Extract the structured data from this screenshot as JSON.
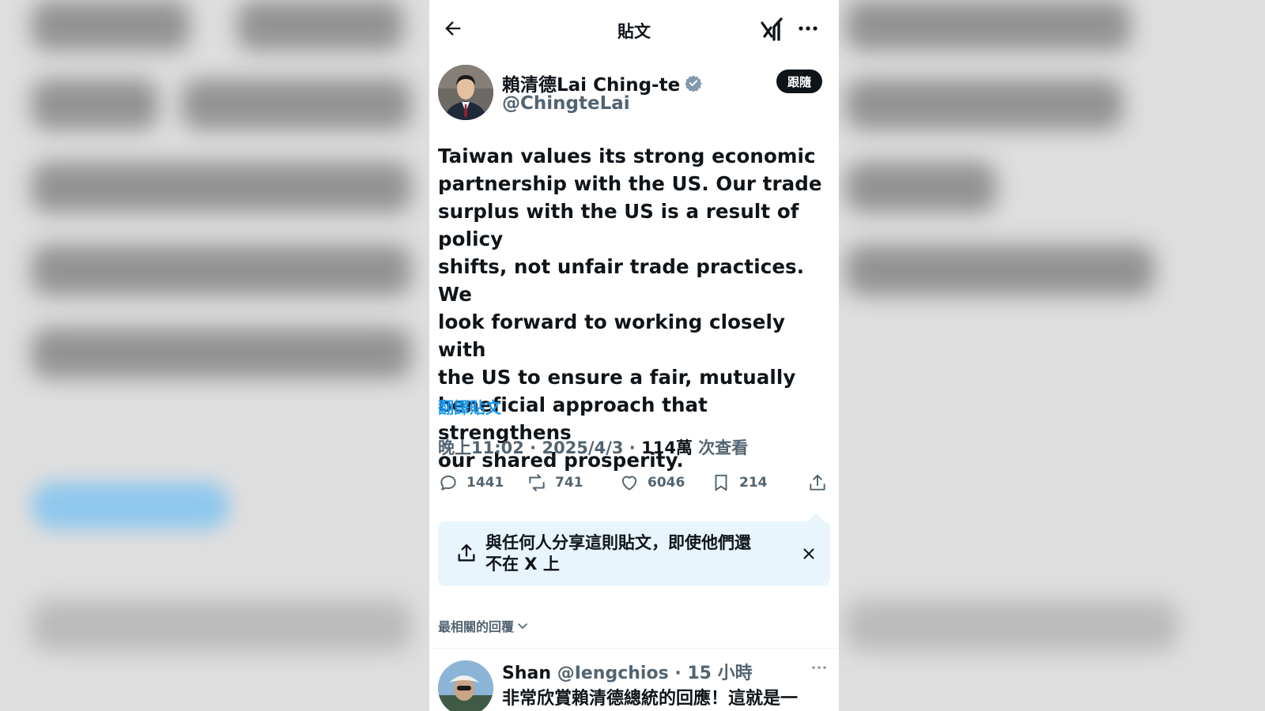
{
  "topbar": {
    "title": "貼文"
  },
  "author": {
    "name": "賴清德Lai Ching-te",
    "handle": "@ChingteLai",
    "follow_label": "跟隨"
  },
  "tweet": {
    "lines": [
      "Taiwan values its strong economic",
      "partnership with the US. Our trade",
      "surplus with the US is a result of policy",
      "shifts, not unfair trade practices. We",
      "look forward to working closely with",
      "the US to ensure a fair, mutually",
      "beneficial approach that strengthens",
      "our shared prosperity."
    ],
    "translate_label": "翻譯貼文",
    "time": "晚上11:02",
    "date": "2025/4/3",
    "views_count": "114萬",
    "views_label": "次查看"
  },
  "actions": {
    "replies": "1441",
    "reposts": "741",
    "likes": "6046",
    "bookmarks": "214"
  },
  "share_card": {
    "text_line1": "與任何人分享這則貼文，即使他們還",
    "text_line2": "不在 X 上"
  },
  "replies_sort": {
    "label": "最相關的回覆"
  },
  "reply": {
    "name": "Shan",
    "handle": "@Iengchios",
    "time": "15 小時",
    "text": "非常欣賞賴清德總統的回應！這就是一"
  },
  "colors": {
    "accent": "#1d9bf0",
    "muted": "#536471",
    "text": "#0f1419",
    "share_bg": "#e8f5fd"
  }
}
